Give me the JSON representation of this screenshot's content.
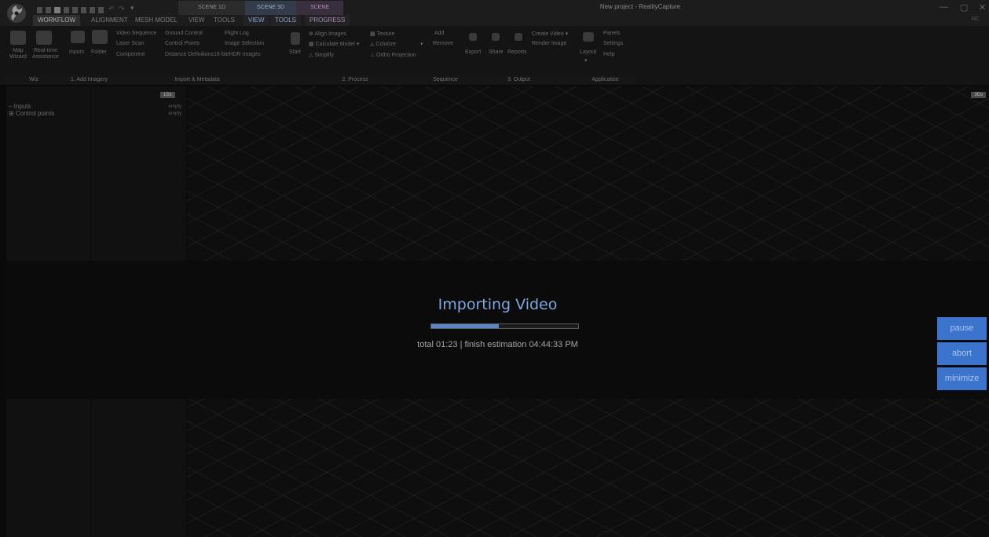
{
  "window": {
    "title": "New project - RealityCapture",
    "user": "RC",
    "controls": [
      "—",
      "▢",
      "✕"
    ]
  },
  "scene_tabs": [
    "SCENE 1D",
    "SCENE 3D",
    "SCENE"
  ],
  "menu": [
    "WORKFLOW",
    "ALIGNMENT",
    "MESH MODEL",
    "VIEW",
    "TOOLS",
    "VIEW",
    "TOOLS",
    "PROGRESS"
  ],
  "ribbon": {
    "wiz": {
      "map_wizard": "Map\nWizard",
      "realtime_assistance": "Real-time\nAssistance",
      "label": "Wiz"
    },
    "add_imagery": {
      "inputs": "Inputs",
      "folder": "Folder",
      "label": "1. Add Imagery"
    },
    "import": {
      "col1": [
        "Video Sequence",
        "Laser Scan",
        "Component"
      ],
      "col2": [
        "Ground Control",
        "Control Points",
        "Distance Definitions"
      ],
      "col3": [
        "Flight Log",
        "Image Selection",
        "16-bit/HDR Images"
      ],
      "label": "Import & Metadata"
    },
    "process": {
      "start": "Start",
      "col1": [
        "Align Images",
        "Calculate Model",
        "Simplify"
      ],
      "col2": [
        "Texture",
        "Colorize",
        "Ortho Projection"
      ],
      "label": "2. Process"
    },
    "sequence": {
      "items": [
        "Add",
        "Remove"
      ],
      "label": "Sequence"
    },
    "output": {
      "export": "Export",
      "share": "Share",
      "reports": "Reports",
      "create_video": "Create Video",
      "render_image": "Render Image",
      "label": "3. Output"
    },
    "application": {
      "layout": "Layout",
      "items": [
        "Panels",
        "Settings",
        "Help"
      ],
      "label": "Application"
    }
  },
  "tree": {
    "items": [
      "Inputs",
      "Control points"
    ],
    "badge": "1Ds"
  },
  "info": {
    "values": [
      "empty",
      "empty"
    ]
  },
  "viewport": {
    "badge": "3Ds"
  },
  "progress": {
    "title": "Importing Video",
    "fraction": 0.46,
    "status": "total 01:23 | finish estimation 04:44:33 PM",
    "buttons": {
      "pause": "pause",
      "abort": "abort",
      "minimize": "minimize"
    }
  }
}
